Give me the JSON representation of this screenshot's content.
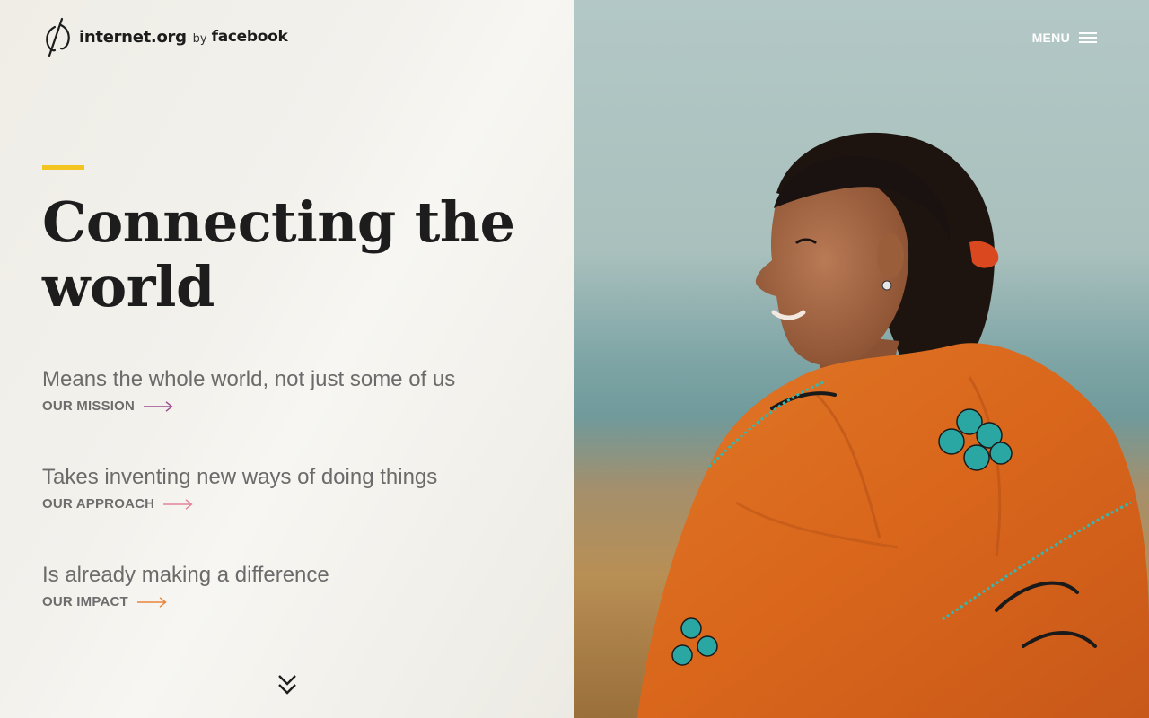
{
  "brand": {
    "name": "internet.org",
    "by": "by",
    "partner": "facebook"
  },
  "nav": {
    "menu_label": "MENU",
    "menu_icon": "hamburger-icon"
  },
  "hero": {
    "headline_line1": "Connecting the",
    "headline_line2": "world",
    "accent_color": "#f4c521",
    "scroll_icon": "double-chevron-down-icon",
    "photo_icon": "woman-in-orange-shawl-photo"
  },
  "features": [
    {
      "text": "Means the whole world, not just some of us",
      "link_label": "OUR MISSION",
      "arrow_color": "#9b4a8e"
    },
    {
      "text": "Takes inventing new ways of doing things",
      "link_label": "OUR APPROACH",
      "arrow_color": "#e2839a"
    },
    {
      "text": "Is already making a difference",
      "link_label": "OUR IMPACT",
      "arrow_color": "#e8833a"
    }
  ]
}
